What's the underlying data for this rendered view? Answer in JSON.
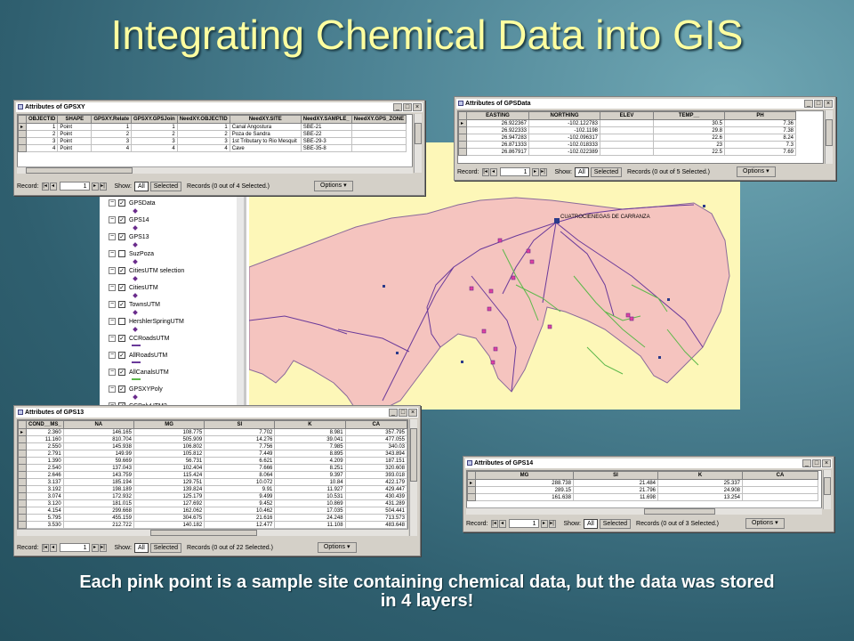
{
  "slide": {
    "title": "Integrating Chemical Data into GIS",
    "caption": "Each pink point is a sample site containing chemical data, but the data was stored in 4 layers!"
  },
  "colors": {
    "title": "#ffffa0",
    "map_background": "#fdf7b8",
    "basin_fill": "#f5c4bf",
    "roads": "#6a3a9a",
    "canals": "#5cb84a",
    "sample_points": "#e040a0"
  },
  "map": {
    "place_label": "CUATROCIENEGAS DE CARRANZA"
  },
  "toc": {
    "layers": [
      {
        "label": "GPSData",
        "checked": true
      },
      {
        "label": "GPS14",
        "checked": true
      },
      {
        "label": "GPS13",
        "checked": true
      },
      {
        "label": "SuzPoza",
        "checked": false
      },
      {
        "label": "CitiesUTM selection",
        "checked": true
      },
      {
        "label": "CitiesUTM",
        "checked": true
      },
      {
        "label": "TownsUTM",
        "checked": true
      },
      {
        "label": "HershlerSpringUTM",
        "checked": false
      },
      {
        "label": "CCRoadsUTM",
        "checked": true
      },
      {
        "label": "AllRoadsUTM",
        "checked": true
      },
      {
        "label": "AllCanalsUTM",
        "checked": true
      },
      {
        "label": "GPSXYPoly",
        "checked": true
      },
      {
        "label": "CCPolyUTM2",
        "checked": true
      }
    ]
  },
  "controls": {
    "record_label": "Record:",
    "show_label": "Show:",
    "all_label": "All",
    "selected_label": "Selected",
    "options_label": "Options",
    "record_value": "1"
  },
  "windows": {
    "gpsxy": {
      "title": "Attributes of GPSXY",
      "columns": [
        "OBJECTID",
        "SHAPE",
        "GPSXY.Relate",
        "GPSXY.GPSJoin",
        "NeedXY.OBJECTID",
        "NeedXY.SITE",
        "NeedXY.SAMPLE_",
        "NeedXY.GPS_ZONE"
      ],
      "rows": [
        [
          "1",
          "Point",
          "1",
          "1",
          "1",
          "Canal Angostura",
          "SBE-21",
          ""
        ],
        [
          "2",
          "Point",
          "2",
          "2",
          "2",
          "Poza de Sandra",
          "SBE-22",
          ""
        ],
        [
          "3",
          "Point",
          "3",
          "3",
          "3",
          "1st Tributary to Rio Mesquit",
          "SBE-29-3",
          ""
        ],
        [
          "4",
          "Point",
          "4",
          "4",
          "4",
          "Cave",
          "SBE-35-8",
          ""
        ]
      ],
      "records_text": "Records (0 out of 4 Selected.)"
    },
    "gpsdata": {
      "title": "Attributes of GPSData",
      "columns": [
        "EASTING",
        "NORTHING",
        "ELEV",
        "TEMP__",
        "PH"
      ],
      "rows": [
        [
          "26.922367",
          "-102.122783",
          "",
          "30.5",
          "7.36"
        ],
        [
          "26.922333",
          "-102.1198",
          "",
          "29.8",
          "7.38"
        ],
        [
          "26.947283",
          "-102.096317",
          "",
          "22.6",
          "8.24"
        ],
        [
          "26.871333",
          "-102.018333",
          "",
          "23",
          "7.3"
        ],
        [
          "26.867917",
          "-102.022389",
          "",
          "22.5",
          "7.69"
        ]
      ],
      "records_text": "Records (0 out of 5 Selected.)"
    },
    "gps13": {
      "title": "Attributes of GPS13",
      "columns": [
        "COND__MS_",
        "NA",
        "MG",
        "SI",
        "K",
        "CA"
      ],
      "rows": [
        [
          "2.360",
          "146.165",
          "108.775",
          "7.702",
          "8.981",
          "357.795"
        ],
        [
          "11.160",
          "810.704",
          "505.909",
          "14.276",
          "39.041",
          "477.055"
        ],
        [
          "2.550",
          "145.938",
          "106.802",
          "7.756",
          "7.985",
          "340.03"
        ],
        [
          "2.791",
          "149.99",
          "105.812",
          "7.449",
          "8.895",
          "343.894"
        ],
        [
          "1.390",
          "59.669",
          "56.731",
          "6.621",
          "4.209",
          "187.151"
        ],
        [
          "2.540",
          "137.043",
          "102.404",
          "7.666",
          "8.251",
          "320.608"
        ],
        [
          "2.646",
          "143.759",
          "115.424",
          "8.064",
          "9.397",
          "393.018"
        ],
        [
          "3.137",
          "185.194",
          "129.751",
          "10.072",
          "10.84",
          "422.179"
        ],
        [
          "3.192",
          "198.189",
          "139.824",
          "9.91",
          "11.927",
          "429.447"
        ],
        [
          "3.074",
          "172.932",
          "125.179",
          "9.499",
          "10.531",
          "430.439"
        ],
        [
          "3.120",
          "181.015",
          "127.692",
          "9.452",
          "10.869",
          "431.289"
        ],
        [
          "4.154",
          "299.668",
          "162.062",
          "10.462",
          "17.035",
          "504.441"
        ],
        [
          "5.795",
          "455.159",
          "304.675",
          "21.616",
          "24.248",
          "713.573"
        ],
        [
          "3.530",
          "212.722",
          "140.182",
          "12.477",
          "11.108",
          "483.648"
        ]
      ],
      "records_text": "Records (0 out of 22 Selected.)"
    },
    "gps14": {
      "title": "Attributes of GPS14",
      "columns": [
        "MG",
        "SI",
        "K",
        "CA"
      ],
      "rows": [
        [
          "288.738",
          "21.484",
          "25.337",
          ""
        ],
        [
          "289.15",
          "21.796",
          "24.908",
          ""
        ],
        [
          "161.638",
          "11.698",
          "13.254",
          ""
        ]
      ],
      "records_text": "Records (0 out of 3 Selected.)"
    }
  }
}
